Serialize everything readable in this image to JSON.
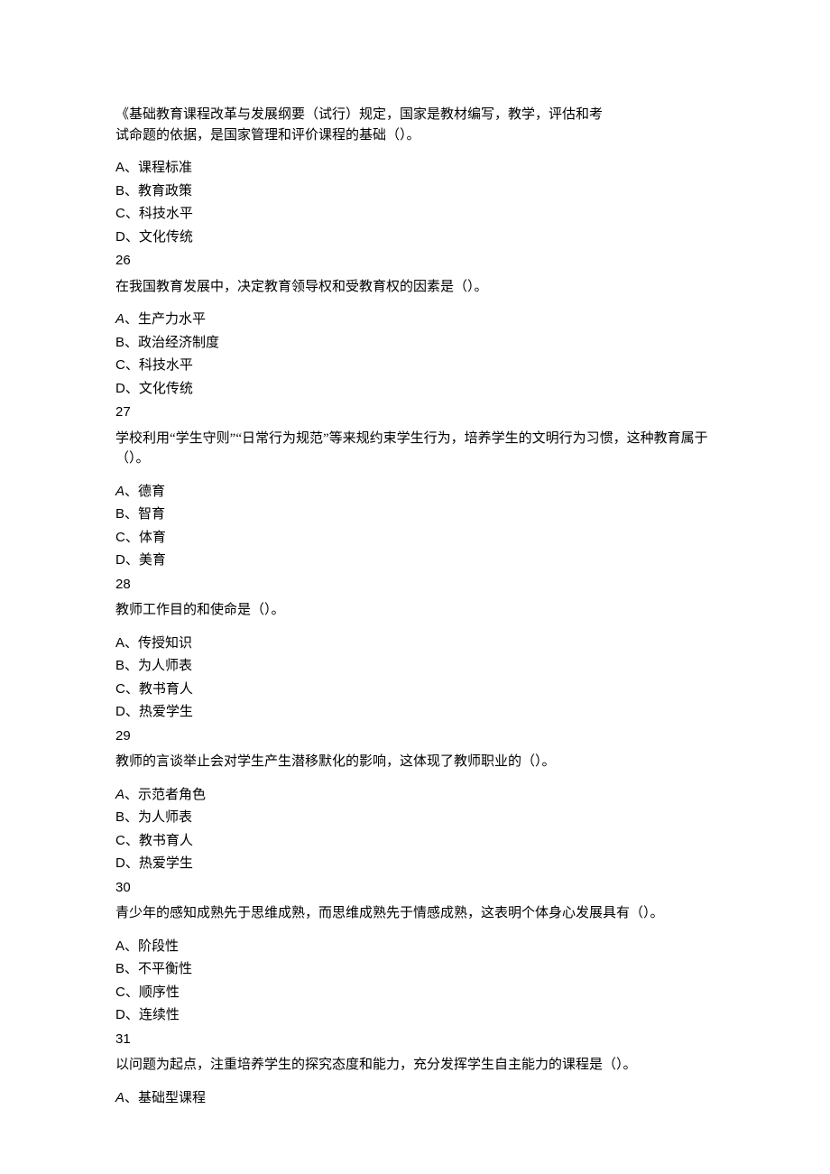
{
  "questions": [
    {
      "stemLines": [
        "《基础教育课程改革与发展纲要（试行）规定，国家是教材编写，教学，评估和考",
        "试命题的依据，是国家管理和评价课程的基础（）。"
      ],
      "options": [
        {
          "letter": "A",
          "italic": false,
          "text": "、课程标准"
        },
        {
          "letter": "B",
          "italic": false,
          "text": "、教育政策"
        },
        {
          "letter": "C",
          "italic": false,
          "text": "、科技水平"
        },
        {
          "letter": "D",
          "italic": false,
          "text": "、文化传统"
        }
      ],
      "next": "26"
    },
    {
      "stemLines": [
        "在我国教育发展中，决定教育领导权和受教育权的因素是（）。"
      ],
      "options": [
        {
          "letter": "A",
          "italic": true,
          "text": "、生产力水平"
        },
        {
          "letter": "B",
          "italic": false,
          "text": "、政治经济制度"
        },
        {
          "letter": "C",
          "italic": false,
          "text": "、科技水平"
        },
        {
          "letter": "D",
          "italic": false,
          "text": "、文化传统"
        }
      ],
      "next": "27"
    },
    {
      "stemLines": [
        "学校利用“学生守则”“日常行为规范”等来规约束学生行为，培养学生的文明行为习惯，这种教育属于（）。"
      ],
      "options": [
        {
          "letter": "A",
          "italic": true,
          "text": "、德育"
        },
        {
          "letter": "B",
          "italic": false,
          "text": "、智育"
        },
        {
          "letter": "C",
          "italic": false,
          "text": "、体育"
        },
        {
          "letter": "D",
          "italic": false,
          "text": "、美育"
        }
      ],
      "next": "28"
    },
    {
      "stemLines": [
        "教师工作目的和使命是（）。"
      ],
      "options": [
        {
          "letter": "A",
          "italic": false,
          "text": "、传授知识"
        },
        {
          "letter": "B",
          "italic": false,
          "text": "、为人师表"
        },
        {
          "letter": "C",
          "italic": false,
          "text": "、教书育人"
        },
        {
          "letter": "D",
          "italic": false,
          "text": "、热爱学生"
        }
      ],
      "next": "29"
    },
    {
      "stemLines": [
        "教师的言谈举止会对学生产生潜移默化的影响，这体现了教师职业的（）。"
      ],
      "options": [
        {
          "letter": "A",
          "italic": true,
          "text": "、示范者角色"
        },
        {
          "letter": "B",
          "italic": false,
          "text": "、为人师表"
        },
        {
          "letter": "C",
          "italic": false,
          "text": "、教书育人"
        },
        {
          "letter": "D",
          "italic": false,
          "text": "、热爱学生"
        }
      ],
      "next": "30"
    },
    {
      "stemLines": [
        "青少年的感知成熟先于思维成熟，而思维成熟先于情感成熟，这表明个体身心发展具有（）。"
      ],
      "options": [
        {
          "letter": "A",
          "italic": false,
          "text": "、阶段性"
        },
        {
          "letter": "B",
          "italic": false,
          "text": "、不平衡性"
        },
        {
          "letter": "C",
          "italic": false,
          "text": "、顺序性"
        },
        {
          "letter": "D",
          "italic": false,
          "text": "、连续性"
        }
      ],
      "next": "31"
    },
    {
      "stemLines": [
        "以问题为起点，注重培养学生的探究态度和能力，充分发挥学生自主能力的课程是（）。"
      ],
      "options": [
        {
          "letter": "A",
          "italic": true,
          "text": "、基础型课程"
        }
      ],
      "next": null
    }
  ]
}
